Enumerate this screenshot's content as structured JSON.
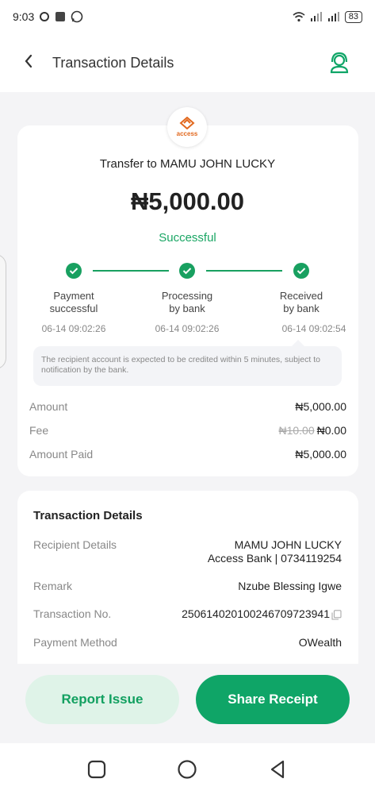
{
  "status_bar": {
    "time": "9:03",
    "battery": "83"
  },
  "header": {
    "title": "Transaction Details",
    "back_icon": "chevron-left-icon",
    "support_icon": "customer-support-icon"
  },
  "bank": {
    "logo_name": "access"
  },
  "summary": {
    "transfer_to": "Transfer to MAMU JOHN LUCKY",
    "amount": "₦5,000.00",
    "status": "Successful"
  },
  "progress": {
    "steps": [
      {
        "label_line1": "Payment",
        "label_line2": "successful",
        "time": "06-14 09:02:26"
      },
      {
        "label_line1": "Processing",
        "label_line2": "by bank",
        "time": "06-14 09:02:26"
      },
      {
        "label_line1": "Received",
        "label_line2": "by bank",
        "time": "06-14 09:02:54"
      }
    ]
  },
  "notice": "The recipient account is expected to be credited within 5 minutes, subject to notification by the bank.",
  "breakdown": {
    "amount_label": "Amount",
    "amount_value": "₦5,000.00",
    "fee_label": "Fee",
    "fee_original": "₦10.00",
    "fee_value": "₦0.00",
    "paid_label": "Amount Paid",
    "paid_value": "₦5,000.00"
  },
  "details": {
    "title": "Transaction Details",
    "recipient_label": "Recipient Details",
    "recipient_name": "MAMU JOHN LUCKY",
    "recipient_bank": "Access Bank | 0734119254",
    "remark_label": "Remark",
    "remark_value": "Nzube Blessing Igwe",
    "txn_label": "Transaction No.",
    "txn_value": "250614020100246709723941",
    "method_label": "Payment Method",
    "method_value": "OWealth"
  },
  "actions": {
    "report": "Report Issue",
    "share": "Share Receipt"
  },
  "colors": {
    "accent": "#0fa567",
    "success_text": "#1aa664",
    "brand_orange": "#e2691f"
  }
}
